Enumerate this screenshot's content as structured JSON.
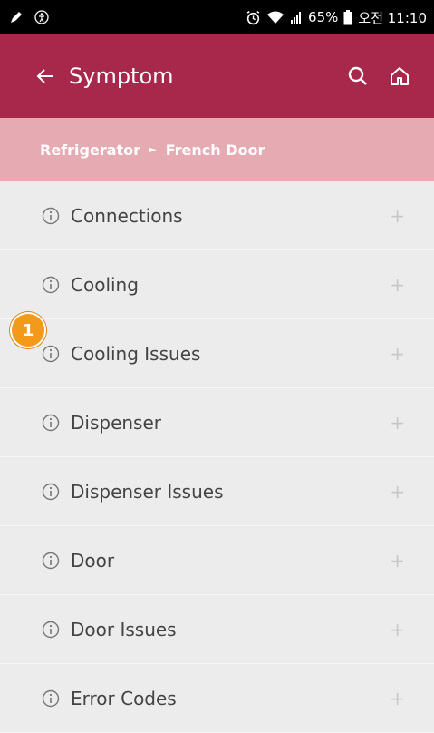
{
  "status_bar": {
    "battery": "65%",
    "time": "오전 11:10",
    "icons": [
      "pen-icon",
      "accessibility-icon",
      "alarm-icon",
      "wifi-icon",
      "signal-icon",
      "battery-icon"
    ]
  },
  "app_bar": {
    "title": "Symptom",
    "back_icon": "arrow-left-icon",
    "actions": [
      "search-icon",
      "home-icon"
    ]
  },
  "breadcrumb": {
    "items": [
      "Refrigerator",
      "French Door"
    ],
    "separator": "►"
  },
  "symptoms": [
    {
      "label": "Connections"
    },
    {
      "label": "Cooling"
    },
    {
      "label": "Cooling Issues"
    },
    {
      "label": "Dispenser"
    },
    {
      "label": "Dispenser Issues"
    },
    {
      "label": "Door"
    },
    {
      "label": "Door Issues"
    },
    {
      "label": "Error Codes"
    }
  ],
  "row_expand_symbol": "+",
  "callout_badge": "1",
  "colors": {
    "app_bar": "#a8284c",
    "breadcrumb": "#e6aab3",
    "list_background": "#ececec",
    "badge": "#f39a1a"
  }
}
